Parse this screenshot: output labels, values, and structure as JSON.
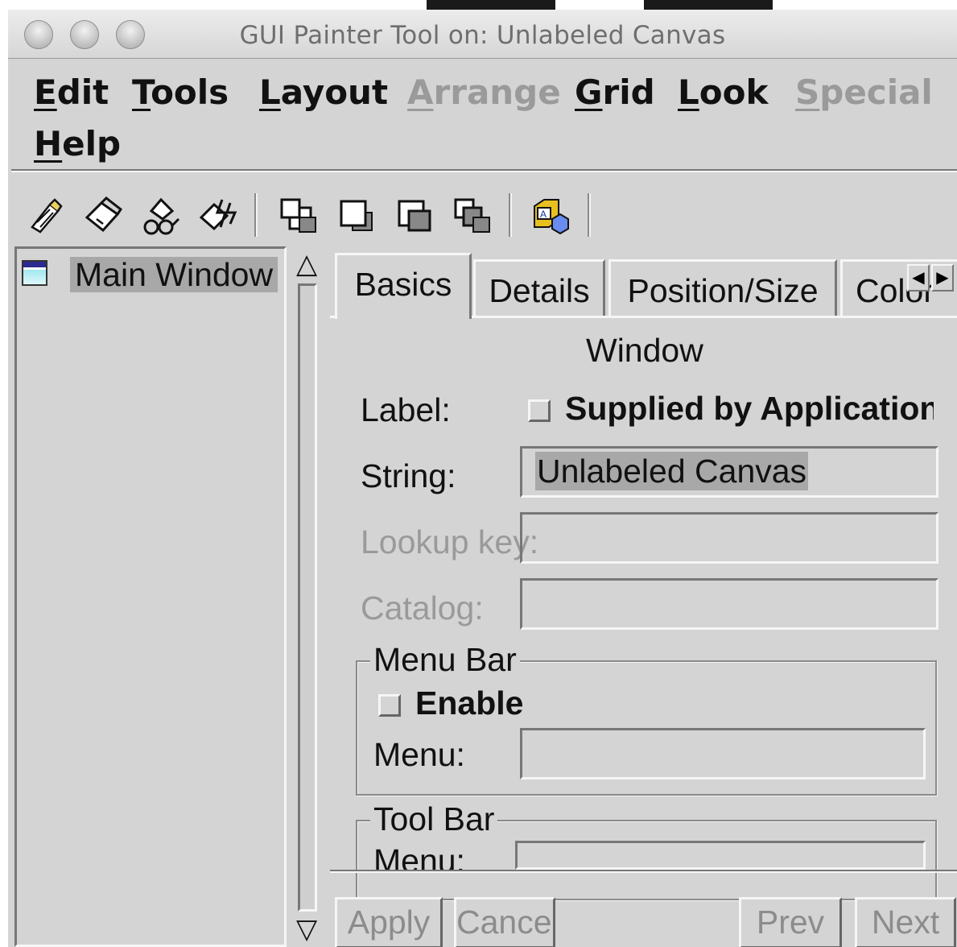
{
  "window": {
    "title": "GUI Painter Tool on: Unlabeled Canvas"
  },
  "menubar": {
    "items": [
      {
        "label": "Edit",
        "mnemonic": "E",
        "rest": "dit",
        "enabled": true
      },
      {
        "label": "Tools",
        "mnemonic": "T",
        "rest": "ools",
        "enabled": true
      },
      {
        "label": "Layout",
        "mnemonic": "L",
        "rest": "ayout",
        "enabled": true
      },
      {
        "label": "Arrange",
        "mnemonic": "A",
        "rest": "rrange",
        "enabled": false
      },
      {
        "label": "Grid",
        "mnemonic": "G",
        "rest": "rid",
        "enabled": true
      },
      {
        "label": "Look",
        "mnemonic": "L",
        "rest": "ook",
        "enabled": true
      },
      {
        "label": "Special",
        "mnemonic": "S",
        "rest": "pecial",
        "enabled": false
      },
      {
        "label": "Help",
        "mnemonic": "H",
        "rest": "elp",
        "enabled": true
      }
    ]
  },
  "toolbar": {
    "icons": [
      "install-icon",
      "define-icon",
      "browse-icon",
      "run-icon",
      "move-to-front-icon",
      "move-to-back-icon",
      "move-forward-icon",
      "move-backward-icon",
      "resources-icon"
    ]
  },
  "tree": {
    "selected_item": "Main Window"
  },
  "tabs": {
    "items": [
      "Basics",
      "Details",
      "Position/Size",
      "Color"
    ],
    "active": "Basics"
  },
  "basics": {
    "section_title": "Window",
    "label_label": "Label:",
    "supplied_by_app": "Supplied by Application",
    "string_label": "String:",
    "string_value": "Unlabeled Canvas",
    "lookup_key_label": "Lookup key:",
    "lookup_key_value": "",
    "catalog_label": "Catalog:",
    "catalog_value": "",
    "menu_bar_group": "Menu Bar",
    "menu_bar_enable": "Enable",
    "menu_bar_menu_label": "Menu:",
    "menu_bar_menu_value": "",
    "tool_bar_group": "Tool Bar",
    "tool_bar_menu_label": "Menu:"
  },
  "buttons": {
    "apply": "Apply",
    "cancel": "Cancel",
    "prev": "Prev",
    "next": "Next"
  },
  "colors": {
    "background": "#d4d4d4",
    "selection": "#a8a8a8",
    "disabled_text": "#9a9a9a"
  }
}
